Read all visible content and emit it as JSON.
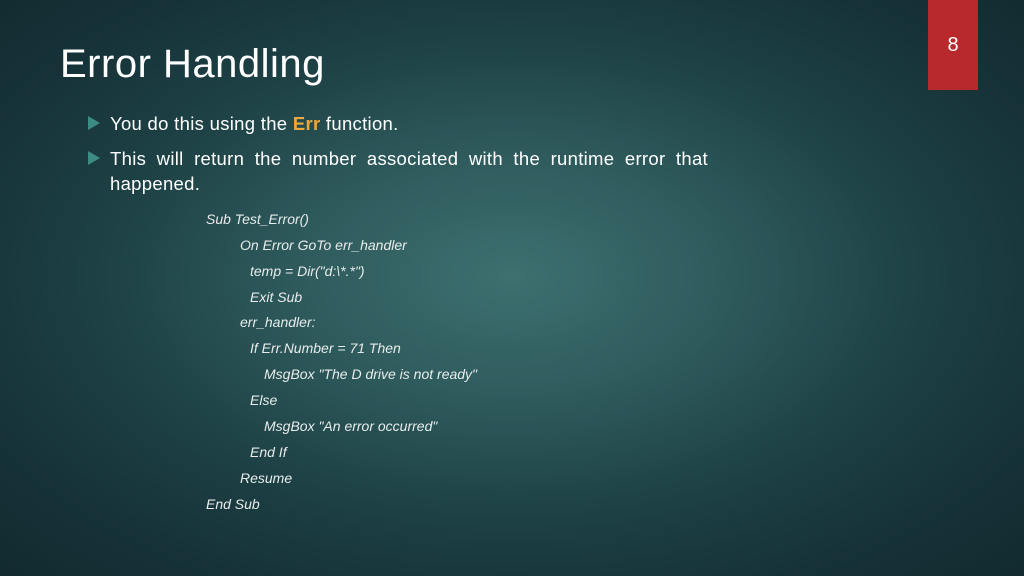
{
  "page_number": "8",
  "title": "Error Handling",
  "bullets": [
    {
      "pre": "You do this using the ",
      "highlight": "Err",
      "post": " function."
    },
    {
      "text": "This will return the number associated with the runtime error that happened."
    }
  ],
  "code": {
    "l0": "Sub Test_Error()",
    "l1": "On Error GoTo err_handler",
    "l2": "temp = Dir(\"d:\\*.*\")",
    "l3": "Exit Sub",
    "l4": "err_handler:",
    "l5": "If Err.Number = 71 Then",
    "l6": "MsgBox \"The D drive is not ready\"",
    "l7": "Else",
    "l8": "MsgBox \"An error occurred\"",
    "l9": "End If",
    "l10": "Resume",
    "l11": "End Sub"
  }
}
